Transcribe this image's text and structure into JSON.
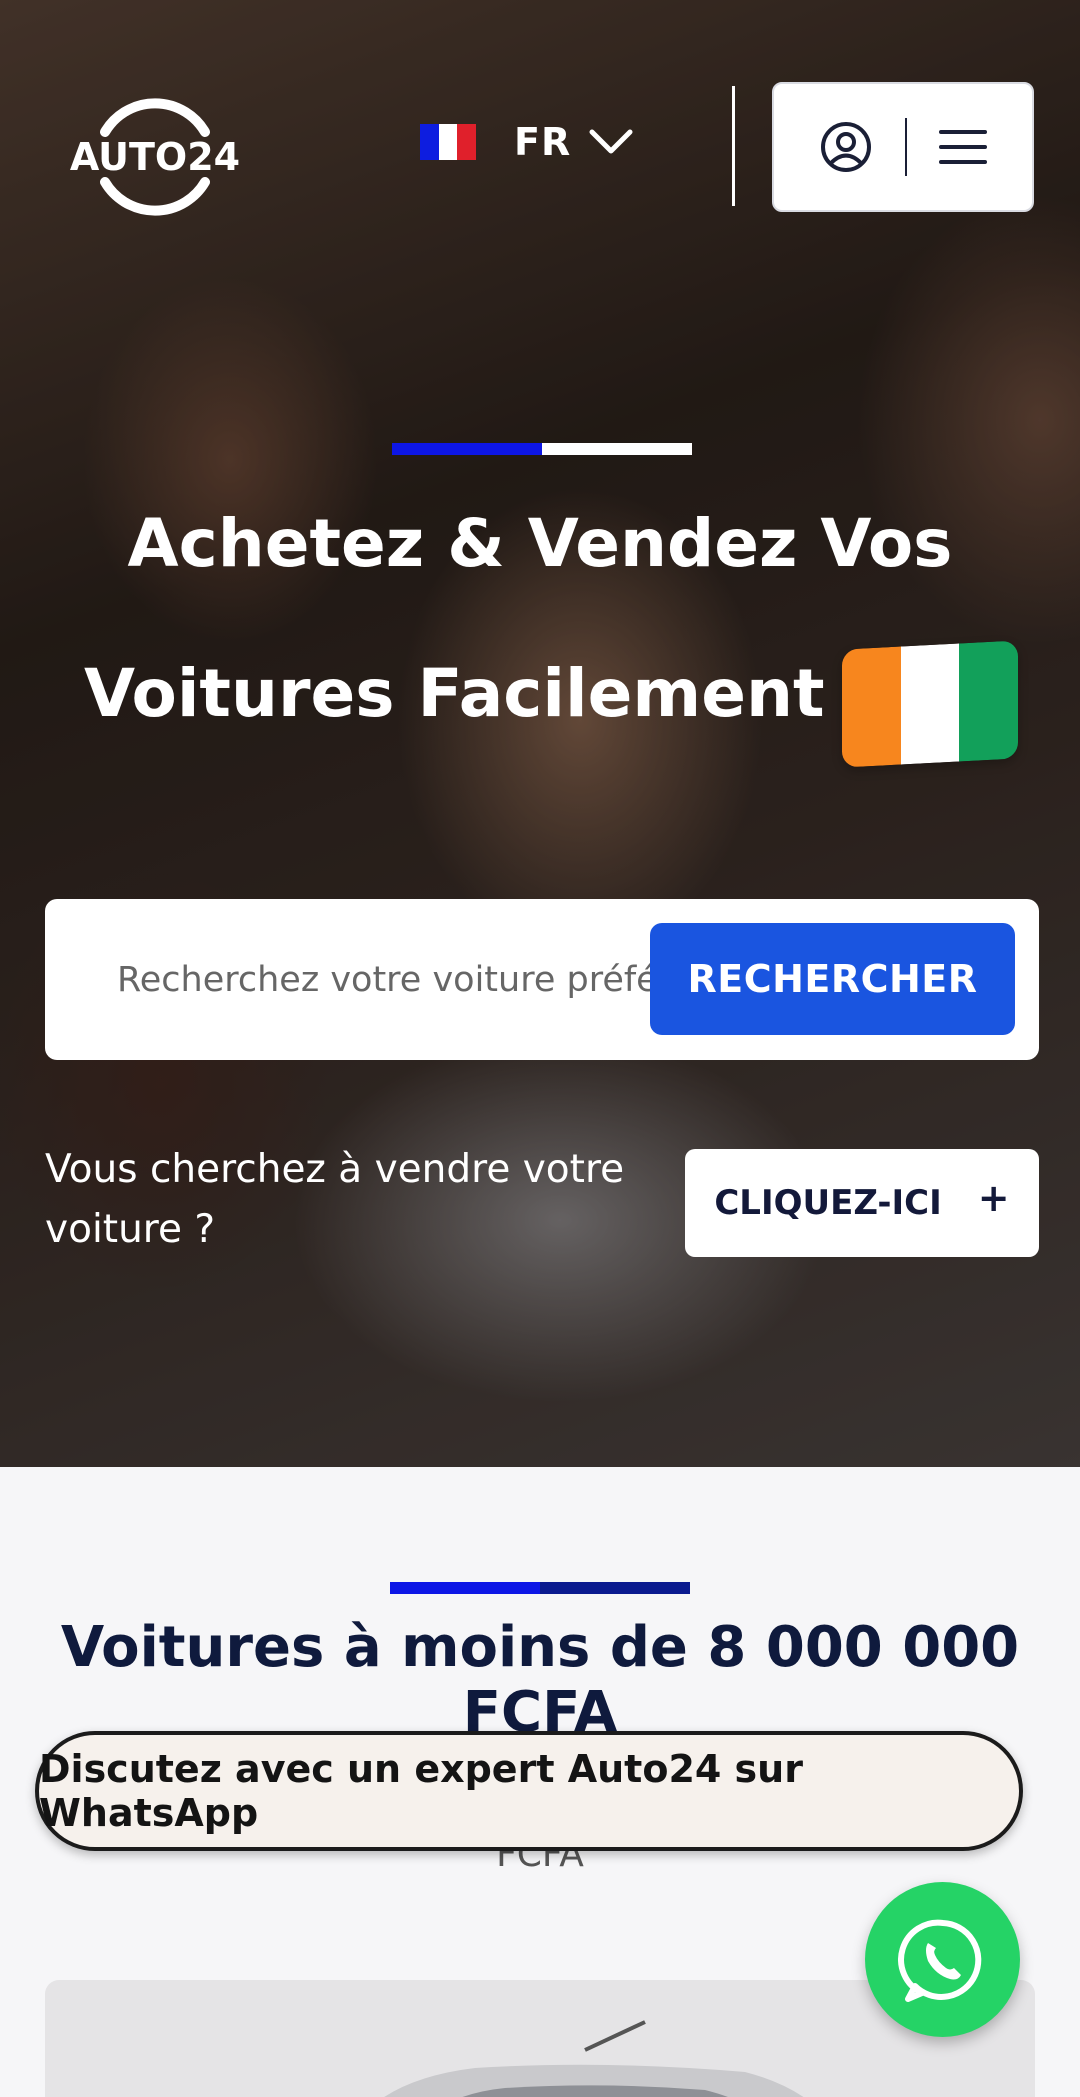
{
  "header": {
    "logo_text": "AUTO24",
    "language_code": "FR",
    "flag_colors": [
      "#0d1de0",
      "#ffffff",
      "#e0202b"
    ]
  },
  "hero": {
    "title_line1": "Achetez & Vendez Vos",
    "title_line2": "Voitures Facilement",
    "country_flag_colors": [
      "#f7861e",
      "#ffffff",
      "#12a05a"
    ],
    "search": {
      "placeholder": "Recherchez votre voiture préférée",
      "button_label": "RECHERCHER"
    },
    "sell": {
      "prompt": "Vous cherchez à vendre votre voiture ?",
      "button_label": "CLIQUEZ-ICI",
      "button_icon": "+"
    }
  },
  "section": {
    "title": "Voitures à moins de 8 000 000 FCFA",
    "subtitle_visible": "FCFA"
  },
  "whatsapp": {
    "banner_label": "Discutez avec un expert Auto24 sur WhatsApp"
  },
  "colors": {
    "accent_blue": "#1a55e0",
    "whatsapp_green": "#25d366",
    "navy_text": "#0f1a3d"
  }
}
